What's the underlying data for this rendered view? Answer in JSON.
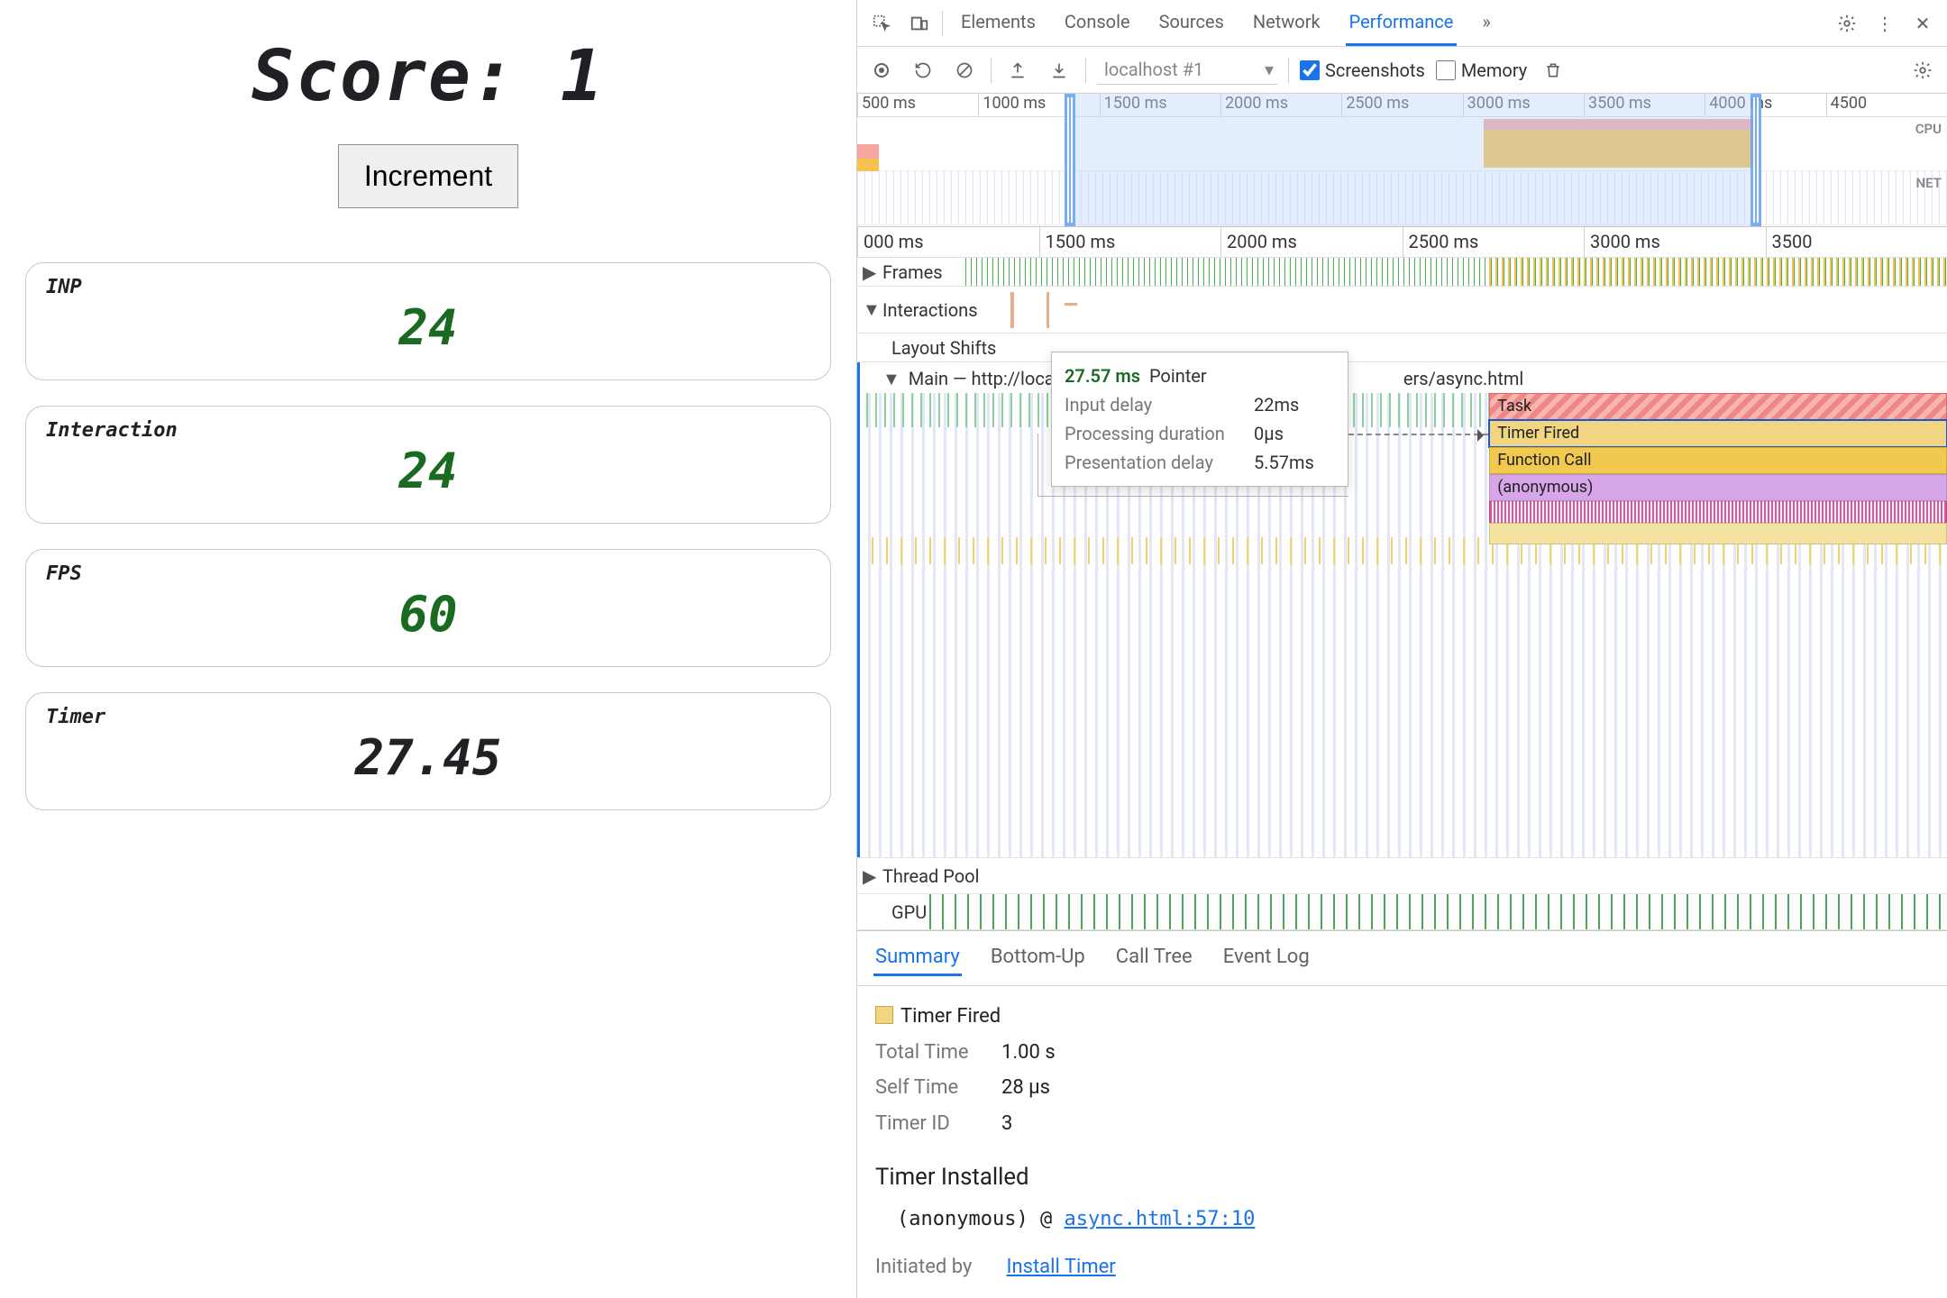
{
  "app": {
    "score_label": "Score:",
    "score_value": "1",
    "increment_label": "Increment",
    "cards": {
      "inp": {
        "label": "INP",
        "value": "24"
      },
      "interaction": {
        "label": "Interaction",
        "value": "24"
      },
      "fps": {
        "label": "FPS",
        "value": "60"
      },
      "timer": {
        "label": "Timer",
        "value": "27.45"
      }
    }
  },
  "devtools": {
    "tabs": [
      "Elements",
      "Console",
      "Sources",
      "Network",
      "Performance"
    ],
    "active_tab": "Performance",
    "more_glyph": "»",
    "perfbar": {
      "recording_dropdown": "localhost #1",
      "screenshots_label": "Screenshots",
      "screenshots_checked": true,
      "memory_label": "Memory",
      "memory_checked": false
    },
    "overview": {
      "ticks": [
        "500 ms",
        "1000 ms",
        "1500 ms",
        "2000 ms",
        "2500 ms",
        "3000 ms",
        "3500 ms",
        "4000 ms",
        "4500"
      ],
      "cpu_label": "CPU",
      "net_label": "NET"
    },
    "flame": {
      "ruler": [
        "000 ms",
        "1500 ms",
        "2000 ms",
        "2500 ms",
        "3000 ms",
        "3500"
      ],
      "frames_label": "Frames",
      "interactions_label": "Interactions",
      "layout_shifts_label": "Layout Shifts",
      "main_label": "Main — http://localho",
      "main_label_suffix": "ers/async.html",
      "thread_pool_label": "Thread Pool",
      "gpu_label": "GPU",
      "bars": {
        "task": "Task",
        "timer_fired": "Timer Fired",
        "function_call": "Function Call",
        "anonymous": "(anonymous)"
      }
    },
    "tooltip": {
      "header_ms": "27.57 ms",
      "header_name": "Pointer",
      "rows": [
        {
          "k": "Input delay",
          "v": "22ms"
        },
        {
          "k": "Processing duration",
          "v": "0µs"
        },
        {
          "k": "Presentation delay",
          "v": "5.57ms"
        }
      ]
    },
    "bottom_tabs": [
      "Summary",
      "Bottom-Up",
      "Call Tree",
      "Event Log"
    ],
    "bottom_active": "Summary",
    "summary": {
      "title": "Timer Fired",
      "total_time_k": "Total Time",
      "total_time_v": "1.00 s",
      "self_time_k": "Self Time",
      "self_time_v": "28 µs",
      "timer_id_k": "Timer ID",
      "timer_id_v": "3",
      "installed_heading": "Timer Installed",
      "installed_fn": "(anonymous)",
      "at": "@",
      "installed_link": "async.html:57:10",
      "initiated_by_k": "Initiated by",
      "initiated_by_link": "Install Timer"
    }
  }
}
